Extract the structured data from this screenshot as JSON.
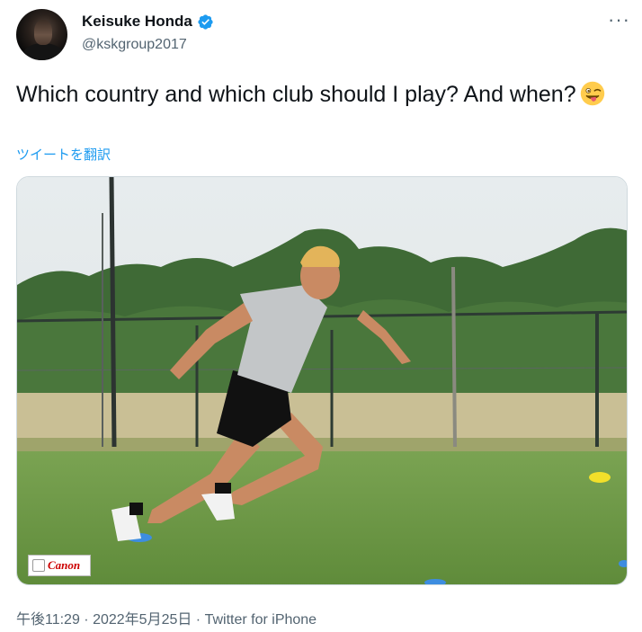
{
  "author": {
    "name": "Keisuke Honda",
    "handle": "@kskgroup2017",
    "verified": true
  },
  "tweet": {
    "text": "Which country and which club should I play? And when?",
    "emoji": "winking-face-with-tongue",
    "translate_label": "ツイートを翻訳",
    "more_label": "···"
  },
  "media": {
    "watermark": "Canon"
  },
  "meta": {
    "timestamp": "午後11:29 · 2022年5月25日 · Twitter for iPhone"
  },
  "colors": {
    "accent": "#1d9bf0",
    "text_primary": "#0f1419",
    "text_secondary": "#536471"
  }
}
